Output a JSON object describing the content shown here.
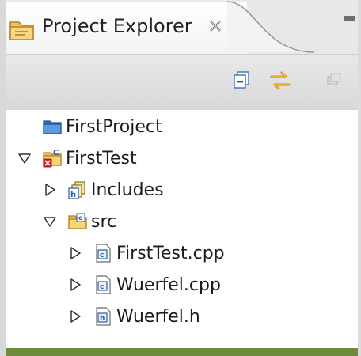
{
  "view": {
    "title": "Project Explorer",
    "tab_icon": "folder-view-icon",
    "close_icon": "close-icon"
  },
  "toolbar": {
    "items": [
      {
        "icon": "collapse-all-icon"
      },
      {
        "icon": "link-with-editor-icon"
      },
      {
        "icon": "view-menu-icon"
      }
    ]
  },
  "tree": {
    "items": [
      {
        "label": "FirstProject",
        "icon": "closed-project-icon",
        "expanded": null
      },
      {
        "label": "FirstTest",
        "icon": "c-project-icon",
        "expanded": true
      },
      {
        "label": "Includes",
        "icon": "includes-icon",
        "expanded": false
      },
      {
        "label": "src",
        "icon": "source-folder-icon",
        "expanded": true
      },
      {
        "label": "FirstTest.cpp",
        "icon": "cpp-file-icon",
        "expanded": false
      },
      {
        "label": "Wuerfel.cpp",
        "icon": "cpp-file-icon",
        "expanded": false
      },
      {
        "label": "Wuerfel.h",
        "icon": "header-file-icon",
        "expanded": false
      }
    ]
  },
  "colors": {
    "accent_orange": "#e8a020",
    "folder_blue": "#3a78c8",
    "status_green": "#6e8a3c"
  }
}
